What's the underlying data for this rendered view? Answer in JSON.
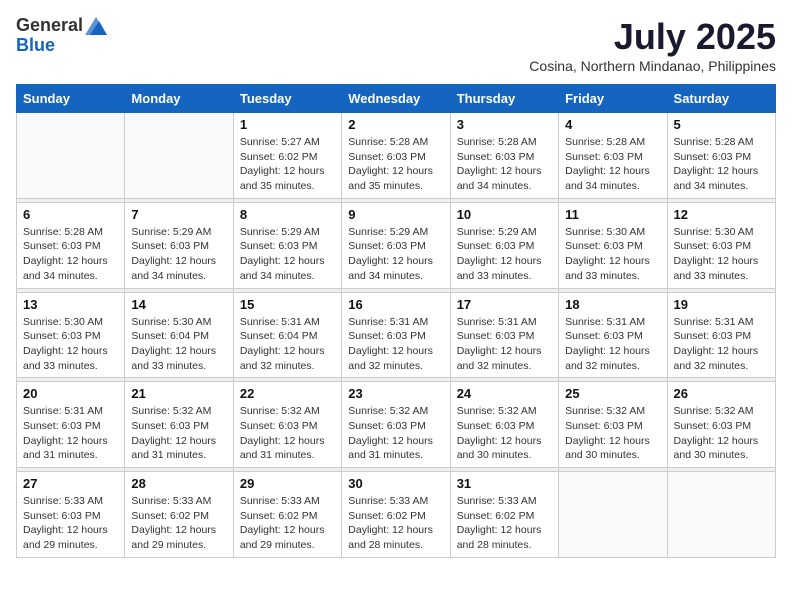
{
  "logo": {
    "general": "General",
    "blue": "Blue"
  },
  "title": {
    "month_year": "July 2025",
    "location": "Cosina, Northern Mindanao, Philippines"
  },
  "weekdays": [
    "Sunday",
    "Monday",
    "Tuesday",
    "Wednesday",
    "Thursday",
    "Friday",
    "Saturday"
  ],
  "weeks": [
    [
      {
        "day": "",
        "info": ""
      },
      {
        "day": "",
        "info": ""
      },
      {
        "day": "1",
        "info": "Sunrise: 5:27 AM\nSunset: 6:02 PM\nDaylight: 12 hours and 35 minutes."
      },
      {
        "day": "2",
        "info": "Sunrise: 5:28 AM\nSunset: 6:03 PM\nDaylight: 12 hours and 35 minutes."
      },
      {
        "day": "3",
        "info": "Sunrise: 5:28 AM\nSunset: 6:03 PM\nDaylight: 12 hours and 34 minutes."
      },
      {
        "day": "4",
        "info": "Sunrise: 5:28 AM\nSunset: 6:03 PM\nDaylight: 12 hours and 34 minutes."
      },
      {
        "day": "5",
        "info": "Sunrise: 5:28 AM\nSunset: 6:03 PM\nDaylight: 12 hours and 34 minutes."
      }
    ],
    [
      {
        "day": "6",
        "info": "Sunrise: 5:28 AM\nSunset: 6:03 PM\nDaylight: 12 hours and 34 minutes."
      },
      {
        "day": "7",
        "info": "Sunrise: 5:29 AM\nSunset: 6:03 PM\nDaylight: 12 hours and 34 minutes."
      },
      {
        "day": "8",
        "info": "Sunrise: 5:29 AM\nSunset: 6:03 PM\nDaylight: 12 hours and 34 minutes."
      },
      {
        "day": "9",
        "info": "Sunrise: 5:29 AM\nSunset: 6:03 PM\nDaylight: 12 hours and 34 minutes."
      },
      {
        "day": "10",
        "info": "Sunrise: 5:29 AM\nSunset: 6:03 PM\nDaylight: 12 hours and 33 minutes."
      },
      {
        "day": "11",
        "info": "Sunrise: 5:30 AM\nSunset: 6:03 PM\nDaylight: 12 hours and 33 minutes."
      },
      {
        "day": "12",
        "info": "Sunrise: 5:30 AM\nSunset: 6:03 PM\nDaylight: 12 hours and 33 minutes."
      }
    ],
    [
      {
        "day": "13",
        "info": "Sunrise: 5:30 AM\nSunset: 6:03 PM\nDaylight: 12 hours and 33 minutes."
      },
      {
        "day": "14",
        "info": "Sunrise: 5:30 AM\nSunset: 6:04 PM\nDaylight: 12 hours and 33 minutes."
      },
      {
        "day": "15",
        "info": "Sunrise: 5:31 AM\nSunset: 6:04 PM\nDaylight: 12 hours and 32 minutes."
      },
      {
        "day": "16",
        "info": "Sunrise: 5:31 AM\nSunset: 6:03 PM\nDaylight: 12 hours and 32 minutes."
      },
      {
        "day": "17",
        "info": "Sunrise: 5:31 AM\nSunset: 6:03 PM\nDaylight: 12 hours and 32 minutes."
      },
      {
        "day": "18",
        "info": "Sunrise: 5:31 AM\nSunset: 6:03 PM\nDaylight: 12 hours and 32 minutes."
      },
      {
        "day": "19",
        "info": "Sunrise: 5:31 AM\nSunset: 6:03 PM\nDaylight: 12 hours and 32 minutes."
      }
    ],
    [
      {
        "day": "20",
        "info": "Sunrise: 5:31 AM\nSunset: 6:03 PM\nDaylight: 12 hours and 31 minutes."
      },
      {
        "day": "21",
        "info": "Sunrise: 5:32 AM\nSunset: 6:03 PM\nDaylight: 12 hours and 31 minutes."
      },
      {
        "day": "22",
        "info": "Sunrise: 5:32 AM\nSunset: 6:03 PM\nDaylight: 12 hours and 31 minutes."
      },
      {
        "day": "23",
        "info": "Sunrise: 5:32 AM\nSunset: 6:03 PM\nDaylight: 12 hours and 31 minutes."
      },
      {
        "day": "24",
        "info": "Sunrise: 5:32 AM\nSunset: 6:03 PM\nDaylight: 12 hours and 30 minutes."
      },
      {
        "day": "25",
        "info": "Sunrise: 5:32 AM\nSunset: 6:03 PM\nDaylight: 12 hours and 30 minutes."
      },
      {
        "day": "26",
        "info": "Sunrise: 5:32 AM\nSunset: 6:03 PM\nDaylight: 12 hours and 30 minutes."
      }
    ],
    [
      {
        "day": "27",
        "info": "Sunrise: 5:33 AM\nSunset: 6:03 PM\nDaylight: 12 hours and 29 minutes."
      },
      {
        "day": "28",
        "info": "Sunrise: 5:33 AM\nSunset: 6:02 PM\nDaylight: 12 hours and 29 minutes."
      },
      {
        "day": "29",
        "info": "Sunrise: 5:33 AM\nSunset: 6:02 PM\nDaylight: 12 hours and 29 minutes."
      },
      {
        "day": "30",
        "info": "Sunrise: 5:33 AM\nSunset: 6:02 PM\nDaylight: 12 hours and 28 minutes."
      },
      {
        "day": "31",
        "info": "Sunrise: 5:33 AM\nSunset: 6:02 PM\nDaylight: 12 hours and 28 minutes."
      },
      {
        "day": "",
        "info": ""
      },
      {
        "day": "",
        "info": ""
      }
    ]
  ]
}
